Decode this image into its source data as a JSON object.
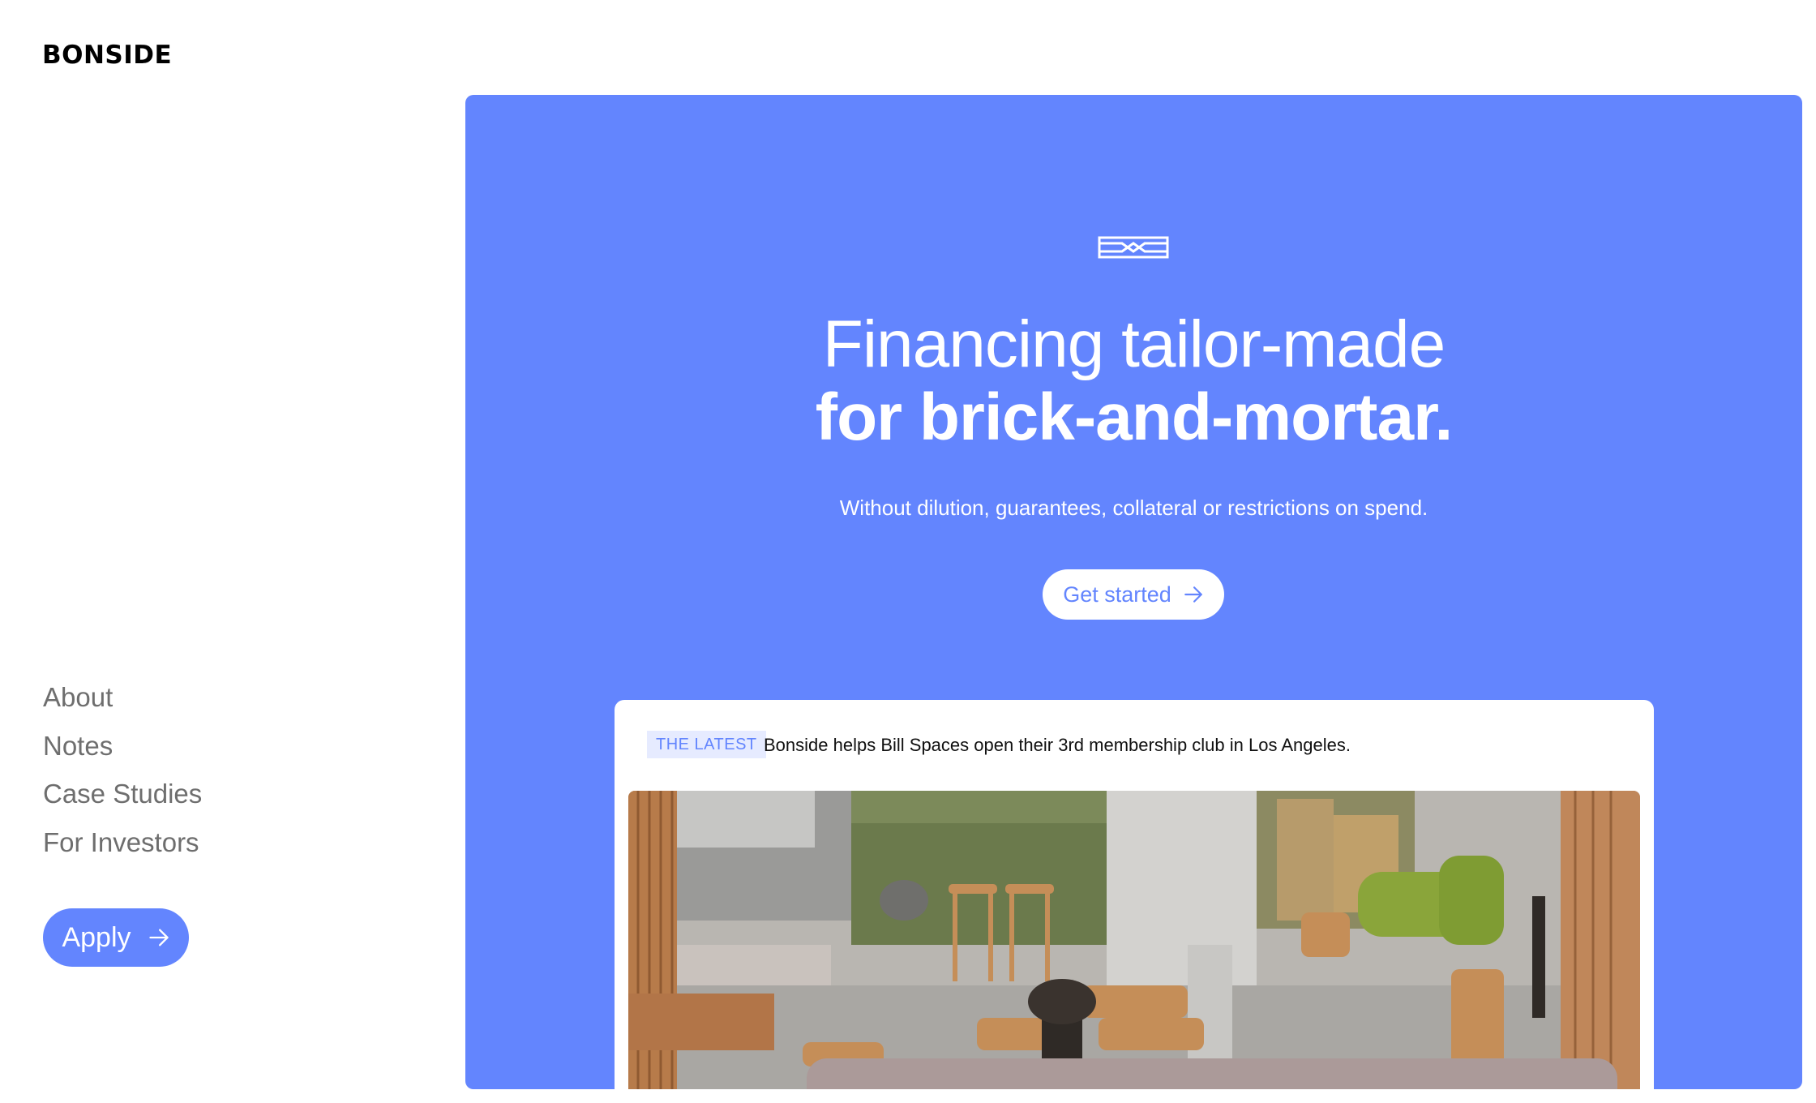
{
  "brand": {
    "name": "BONSIDE"
  },
  "nav": {
    "items": [
      {
        "label": "About"
      },
      {
        "label": "Notes"
      },
      {
        "label": "Case Studies"
      },
      {
        "label": "For Investors"
      }
    ]
  },
  "apply": {
    "label": "Apply",
    "icon": "arrow-right-icon"
  },
  "hero": {
    "mark_icon": "bonside-mark-icon",
    "headline_line1": "Financing tailor-made",
    "headline_line2": "for brick-and-mortar.",
    "subtitle": "Without dilution, guarantees, collateral or restrictions on spend.",
    "cta_label": "Get started",
    "cta_icon": "arrow-right-icon"
  },
  "latest": {
    "badge": "THE LATEST",
    "text": "Bonside helps Bill Spaces open their 3rd membership club in Los Angeles."
  },
  "colors": {
    "accent": "#6385fe",
    "badge_bg": "#e6ebff",
    "nav_text": "#6e6e6e",
    "background": "#ffffff"
  }
}
